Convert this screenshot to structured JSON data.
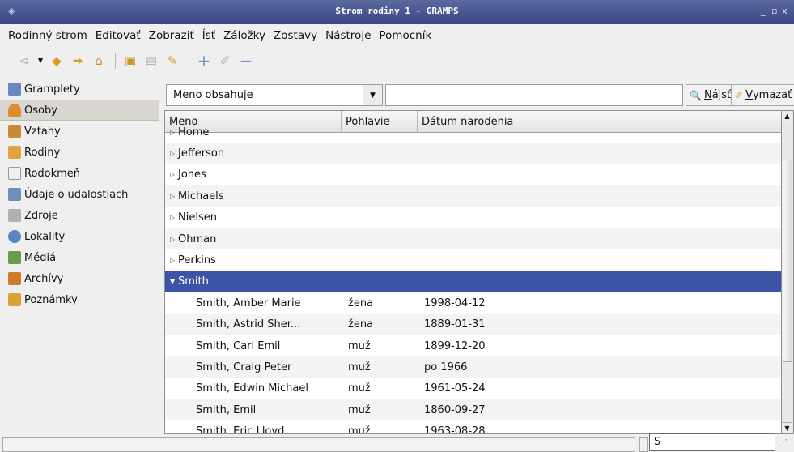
{
  "window": {
    "title": "Strom rodiny 1 - GRAMPS",
    "controls": [
      "_",
      "▫",
      "x"
    ]
  },
  "menu": [
    "Rodinný strom",
    "Editovať",
    "Zobraziť",
    "Ísť",
    "Záložky",
    "Zostavy",
    "Nástroje",
    "Pomocník"
  ],
  "toolbar": {
    "icons": [
      "back-icon",
      "dropdown-arrow-icon",
      "go-back-icon",
      "go-forward-icon",
      "home-icon",
      "clipboard-icon",
      "print-icon",
      "tools-icon",
      "add-icon",
      "edit-icon",
      "remove-icon"
    ]
  },
  "sidebar": {
    "items": [
      {
        "label": "Gramplety",
        "icon": "gramplets-icon",
        "color": "#6a88c0"
      },
      {
        "label": "Osoby",
        "icon": "person-icon",
        "color": "#e38a2a"
      },
      {
        "label": "Vzťahy",
        "icon": "relationships-icon",
        "color": "#c88a3a"
      },
      {
        "label": "Rodiny",
        "icon": "families-icon",
        "color": "#e6a23c"
      },
      {
        "label": "Rodokmeň",
        "icon": "pedigree-icon",
        "color": "#9a9a9a"
      },
      {
        "label": "Údaje o udalostiach",
        "icon": "events-icon",
        "color": "#6e8fb8"
      },
      {
        "label": "Zdroje",
        "icon": "sources-icon",
        "color": "#8a8a8a"
      },
      {
        "label": "Lokality",
        "icon": "places-icon",
        "color": "#5b86c4"
      },
      {
        "label": "Médiá",
        "icon": "media-icon",
        "color": "#6a9a4a"
      },
      {
        "label": "Archívy",
        "icon": "repositories-icon",
        "color": "#d07a2a"
      },
      {
        "label": "Poznámky",
        "icon": "notes-icon",
        "color": "#d8a43a"
      }
    ],
    "active_index": 1
  },
  "filter": {
    "combo_value": "Meno obsahuje",
    "search_value": "",
    "find_prefix": "",
    "find_mnemonic": "N",
    "find_rest": "ájsť",
    "clear_mnemonic": "V",
    "clear_rest": "ymazať"
  },
  "table": {
    "columns": [
      "Meno",
      "Pohlavie",
      "Dátum narodenia"
    ],
    "partial_top": "Home",
    "groups": [
      "Jefferson",
      "Jones",
      "Michaels",
      "Nielsen",
      "Ohman",
      "Perkins"
    ],
    "selected_group": "Smith",
    "people": [
      {
        "name": "Smith, Amber Marie",
        "sex": "žena",
        "birth": "1998-04-12"
      },
      {
        "name": "Smith, Astrid Sher...",
        "sex": "žena",
        "birth": "1889-01-31"
      },
      {
        "name": "Smith, Carl Emil",
        "sex": "muž",
        "birth": "1899-12-20"
      },
      {
        "name": "Smith, Craig Peter",
        "sex": "muž",
        "birth": "po 1966"
      },
      {
        "name": "Smith, Edwin Michael",
        "sex": "muž",
        "birth": "1961-05-24"
      },
      {
        "name": "Smith, Emil",
        "sex": "muž",
        "birth": "1860-09-27"
      },
      {
        "name": "Smith, Eric Lloyd",
        "sex": "muž",
        "birth": "1963-08-28"
      }
    ]
  },
  "status": {
    "typeahead_value": "S"
  }
}
